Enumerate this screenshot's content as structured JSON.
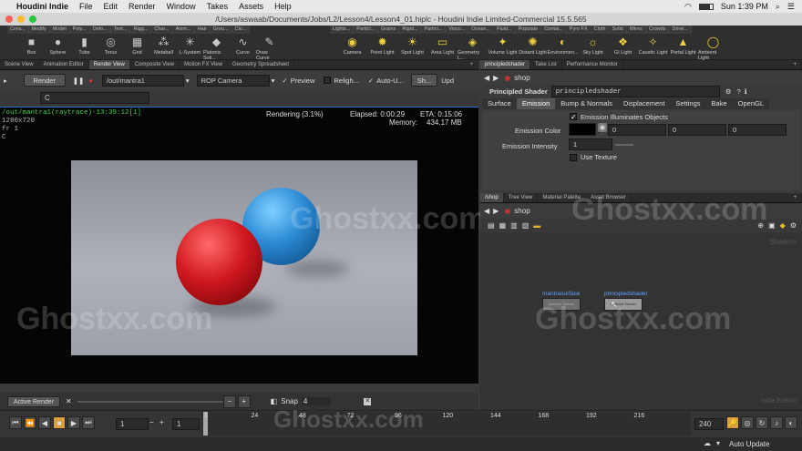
{
  "mac": {
    "apple": "",
    "app": "Houdini Indie",
    "menus": [
      "File",
      "Edit",
      "Render",
      "Window",
      "Takes",
      "Assets",
      "Help"
    ],
    "time": "Sun 1:39 PM"
  },
  "window": {
    "title": "/Users/aswaab/Documents/Jobs/L2/Lesson4/Lesson4_01.hiplc - Houdini Indie Limited-Commercial 15.5.565"
  },
  "shelf": {
    "tabs_left": [
      "Crea...",
      "Modify",
      "Model",
      "Poly...",
      "Defo...",
      "Text...",
      "Rigg...",
      "Char...",
      "Anim...",
      "Hair",
      "Grou...",
      "Clo..."
    ],
    "tools_left": [
      {
        "label": "Box",
        "icon": "box-icon"
      },
      {
        "label": "Sphere",
        "icon": "sphere-icon"
      },
      {
        "label": "Tube",
        "icon": "tube-icon"
      },
      {
        "label": "Torus",
        "icon": "torus-icon"
      },
      {
        "label": "Grid",
        "icon": "grid-icon"
      },
      {
        "label": "Metaball",
        "icon": "metaball-icon"
      },
      {
        "label": "L-System",
        "icon": "lsystem-icon"
      },
      {
        "label": "Platonic Soli...",
        "icon": "platonic-icon"
      },
      {
        "label": "Curve",
        "icon": "curve-icon"
      },
      {
        "label": "Draw Curve",
        "icon": "draw-curve-icon"
      }
    ],
    "tabs_right": [
      "Lights...",
      "Particl...",
      "Grains",
      "Rigid...",
      "Particl...",
      "Visco...",
      "Ocean...",
      "Fluid...",
      "Populate",
      "Contai...",
      "Pyro FX",
      "Cloth",
      "Solid",
      "Wires",
      "Crowds",
      "Drive..."
    ],
    "tools_right": [
      {
        "label": "Camera",
        "icon": "camera-icon"
      },
      {
        "label": "Point Light",
        "icon": "point-light-icon"
      },
      {
        "label": "Spot Light",
        "icon": "spot-light-icon"
      },
      {
        "label": "Area Light",
        "icon": "area-light-icon"
      },
      {
        "label": "Geometry L...",
        "icon": "geometry-light-icon"
      },
      {
        "label": "Volume Light",
        "icon": "volume-light-icon"
      },
      {
        "label": "Distant Light",
        "icon": "distant-light-icon"
      },
      {
        "label": "Environmen...",
        "icon": "environment-light-icon"
      },
      {
        "label": "Sky Light",
        "icon": "sky-light-icon"
      },
      {
        "label": "GI Light",
        "icon": "gi-light-icon"
      },
      {
        "label": "Caustic Light",
        "icon": "caustic-light-icon"
      },
      {
        "label": "Portal Light",
        "icon": "portal-light-icon"
      },
      {
        "label": "Ambient Light",
        "icon": "ambient-light-icon"
      }
    ]
  },
  "left": {
    "tabs": [
      "Scene View",
      "Animation Editor",
      "Render View",
      "Composite View",
      "Motion FX View",
      "Geometry Spreadsheet"
    ],
    "render_btn": "Render",
    "out_path": "/out/mantra1",
    "camera": "ROP Camera",
    "preview": "Preview",
    "relight": "Religh...",
    "autoupdate": "Auto-U...",
    "sh": "Sh...",
    "upd": "Upd",
    "c_field": "C",
    "render_info": {
      "name": "/out/mantra1(raytrace)-13:39:12[1]",
      "res": "1280x720",
      "fr": "fr 1",
      "ch": "C",
      "status": "Rendering (3.1%)",
      "elapsed": "Elapsed: 0:00:29",
      "eta": "ETA: 0:15:06",
      "memory": "Memory:",
      "mem_val": "434.17 MB"
    },
    "active_render": "Active Render",
    "snap": "Snap",
    "snap_val": "4"
  },
  "right": {
    "top_tabs": [
      "principledshader",
      "Take List",
      "Performance Monitor"
    ],
    "path": "shop",
    "node_type": "Principled Shader",
    "node_name": "principledshader",
    "param_tabs": [
      "Surface",
      "Emission",
      "Bump & Normals",
      "Displacement",
      "Settings",
      "Bake",
      "OpenGL"
    ],
    "emission_illum": "Emission Illuminates Objects",
    "emission_color": "Emission Color",
    "emission_color_vals": [
      "0",
      "0",
      "0"
    ],
    "emission_intensity": "Emission Intensity",
    "emission_intensity_val": "1",
    "use_texture": "Use Texture",
    "bottom_tabs": [
      "/shop",
      "Tree View",
      "Material Palette",
      "Asset Browser"
    ],
    "net_path": "shop",
    "net_label": "Shaders",
    "nodes": [
      {
        "name": "mantrasurface",
        "sub": "Material Shader"
      },
      {
        "name": "principledshader",
        "sub": "Material Shader"
      }
    ],
    "edition": "Indie Edition"
  },
  "timeline": {
    "frame": "1",
    "start": "1",
    "end": "240",
    "ticks": [
      "1",
      "24",
      "48",
      "72",
      "96",
      "120",
      "144",
      "168",
      "192",
      "216"
    ]
  },
  "status": {
    "auto_update": "Auto Update"
  },
  "watermark": "Ghostxx.com",
  "colors": {
    "accent": "#2a70d0",
    "render_text": "#4cd04c",
    "node_label": "#5ea4ff"
  }
}
